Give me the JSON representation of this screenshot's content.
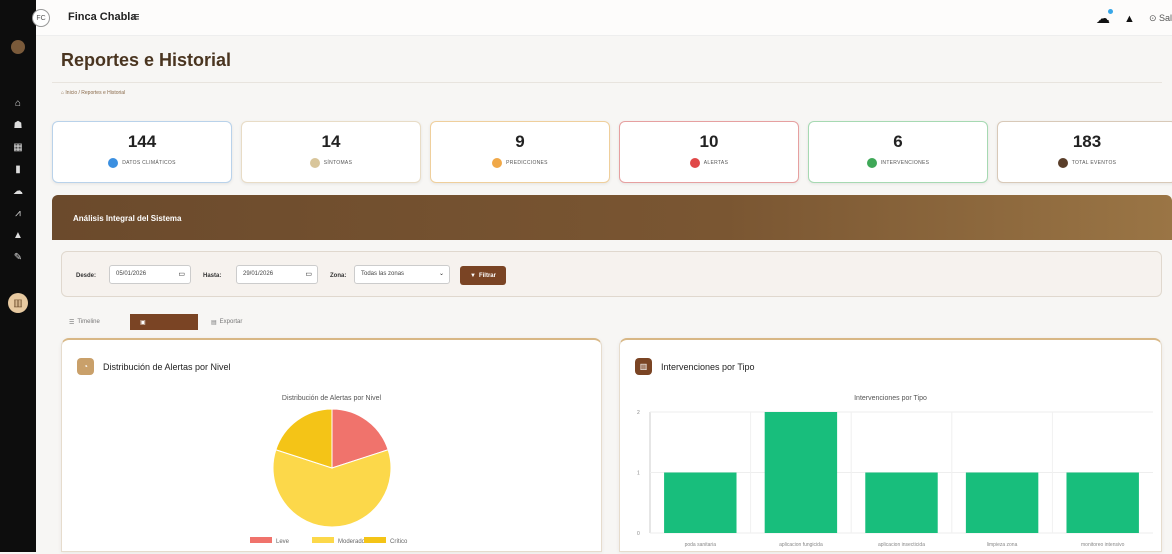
{
  "app": {
    "brand": "Finca Chabla",
    "logo_text": "FC",
    "user_link": "⊙ Sal"
  },
  "icons": {
    "menu": "hamburger-menu-icon",
    "weather": "cloud-icon",
    "notifications": "bell-icon",
    "calendar": "calendar-icon",
    "filter": "filter-icon"
  },
  "sidebar": {
    "items": [
      {
        "name": "home",
        "glyph": "⌂"
      },
      {
        "name": "users",
        "glyph": "☗"
      },
      {
        "name": "grid",
        "glyph": "▦"
      },
      {
        "name": "clipboard",
        "glyph": "▮"
      },
      {
        "name": "cloud",
        "glyph": "☁"
      },
      {
        "name": "chart",
        "glyph": "⩘"
      },
      {
        "name": "bell",
        "glyph": "▲"
      },
      {
        "name": "wrench",
        "glyph": "✎"
      }
    ],
    "active_glyph": "▥"
  },
  "page": {
    "title": "Reportes e Historial",
    "breadcrumb": [
      "Inicio",
      "Reportes e Historial"
    ]
  },
  "stats": [
    {
      "value": "144",
      "label": "DATOS CLIMÁTICOS",
      "color": "#3b8fe0",
      "border": "#b9d2ea"
    },
    {
      "value": "14",
      "label": "SÍNTOMAS",
      "color": "#d8c59a",
      "border": "#e8dcc6"
    },
    {
      "value": "9",
      "label": "PREDICCIONES",
      "color": "#f0a848",
      "border": "#efcf9c"
    },
    {
      "value": "10",
      "label": "ALERTAS",
      "color": "#e04848",
      "border": "#e6a0a0"
    },
    {
      "value": "6",
      "label": "INTERVENCIONES",
      "color": "#3fa858",
      "border": "#a6d9b2"
    },
    {
      "value": "183",
      "label": "TOTAL EVENTOS",
      "color": "#5a3e2a",
      "border": "#d8c9b8"
    }
  ],
  "banner": {
    "title": "Análisis Integral del Sistema"
  },
  "filters": {
    "desde_label": "Desde:",
    "desde_value": "05/01/2026",
    "hasta_label": "Hasta:",
    "hasta_value": "29/01/2026",
    "zona_label": "Zona:",
    "zona_value": "Todas las zonas",
    "filter_button": "Filtrar"
  },
  "tabs": [
    {
      "label": "Timeline",
      "glyph": "☰",
      "active": false
    },
    {
      "label": "",
      "glyph": "▣",
      "active": true
    },
    {
      "label": "Exportar",
      "glyph": "▤",
      "active": false
    }
  ],
  "panels": {
    "alerts": {
      "title": "Distribución de Alertas por Nivel",
      "icon_color": "#c9a06a"
    },
    "interventions": {
      "title": "Intervenciones por Tipo",
      "icon_color": "#7a4424"
    }
  },
  "chart_data": [
    {
      "type": "pie",
      "title": "Distribución de Alertas por Nivel",
      "categories": [
        "Leve",
        "Moderado",
        "Crítico"
      ],
      "values": [
        2,
        6,
        2
      ],
      "colors": [
        "#f0736c",
        "#fcd84a",
        "#f4c417"
      ],
      "legend": "bottom"
    },
    {
      "type": "bar",
      "title": "Intervenciones por Tipo",
      "categories": [
        "poda sanitaria",
        "aplicacion fungicida",
        "aplicacion insecticida",
        "limpieza zona",
        "monitoreo intensivo"
      ],
      "values": [
        1,
        2,
        1,
        1,
        1
      ],
      "ylim": [
        0,
        2
      ],
      "yticks": [
        0,
        1,
        2
      ],
      "color": "#18be7c",
      "grid": true
    }
  ]
}
